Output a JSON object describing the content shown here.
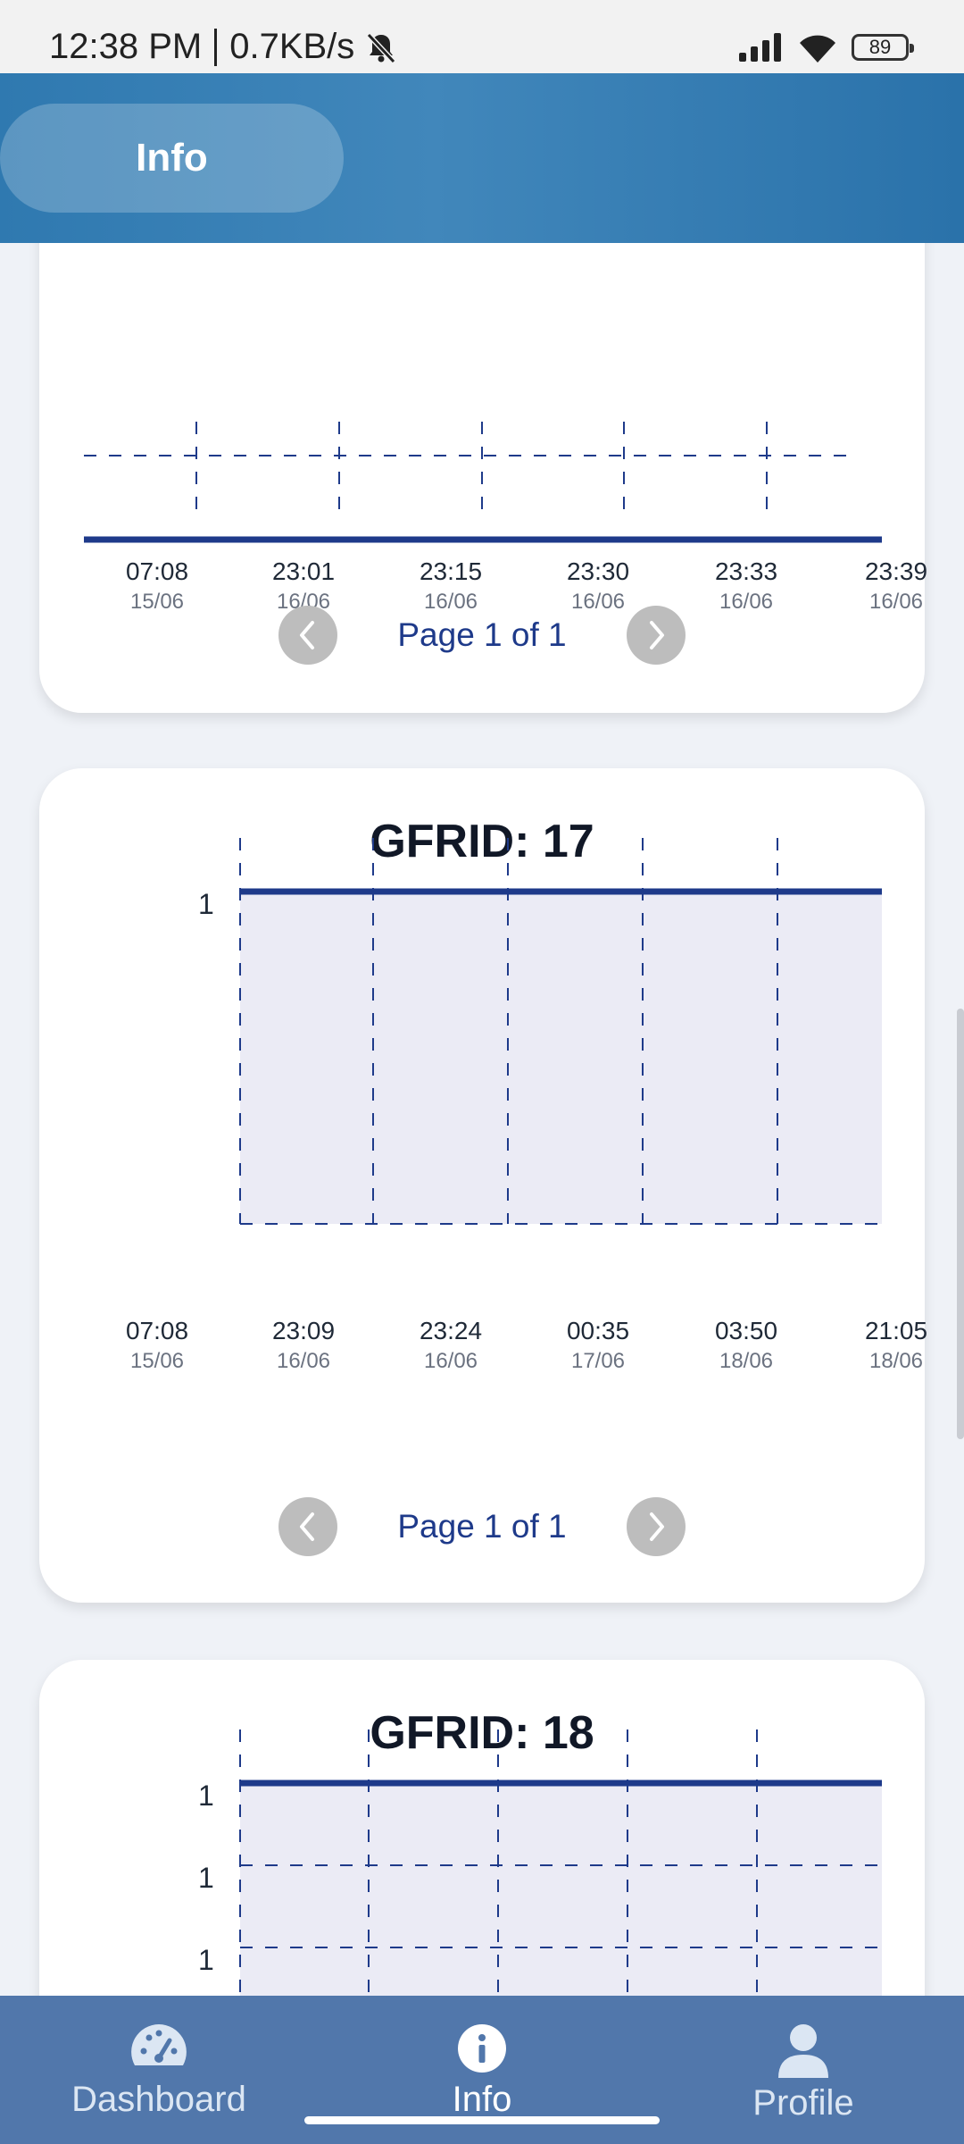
{
  "status_bar": {
    "time": "12:38 PM",
    "speed": "0.7KB/s",
    "battery": "89",
    "icons": [
      "bell-muted-icon",
      "signal-icon",
      "wifi-icon",
      "battery-icon"
    ]
  },
  "header": {
    "title": "Info"
  },
  "cards": [
    {
      "title": "",
      "pager": {
        "label": "Page 1 of 1"
      },
      "x_ticks": [
        {
          "time": "07:08",
          "date": "15/06"
        },
        {
          "time": "23:01",
          "date": "16/06"
        },
        {
          "time": "23:15",
          "date": "16/06"
        },
        {
          "time": "23:30",
          "date": "16/06"
        },
        {
          "time": "23:33",
          "date": "16/06"
        },
        {
          "time": "23:39",
          "date": "16/06"
        }
      ]
    },
    {
      "title": "GFRID: 17",
      "pager": {
        "label": "Page 1 of 1"
      },
      "y_ticks": [
        "1"
      ],
      "x_ticks": [
        {
          "time": "07:08",
          "date": "15/06"
        },
        {
          "time": "23:09",
          "date": "16/06"
        },
        {
          "time": "23:24",
          "date": "16/06"
        },
        {
          "time": "00:35",
          "date": "17/06"
        },
        {
          "time": "03:50",
          "date": "18/06"
        },
        {
          "time": "21:05",
          "date": "18/06"
        }
      ]
    },
    {
      "title": "GFRID: 18",
      "y_ticks": [
        "1",
        "1",
        "1"
      ]
    }
  ],
  "chart_data": [
    {
      "type": "area",
      "title": "",
      "categories": [
        "07:08 15/06",
        "23:01 16/06",
        "23:15 16/06",
        "23:30 16/06",
        "23:33 16/06",
        "23:39 16/06"
      ],
      "series": [
        {
          "values": [
            1,
            1,
            1,
            1,
            1,
            1
          ]
        }
      ],
      "grid": true,
      "color": "#1e3a8a"
    },
    {
      "type": "area",
      "title": "GFRID: 17",
      "categories": [
        "07:08 15/06",
        "23:09 16/06",
        "23:24 16/06",
        "00:35 17/06",
        "03:50 18/06",
        "21:05 18/06"
      ],
      "series": [
        {
          "values": [
            1,
            1,
            1,
            1,
            1,
            1
          ]
        }
      ],
      "y_ticks": [
        "1"
      ],
      "grid": true,
      "color": "#1e3a8a",
      "fill": "#ebebf5"
    },
    {
      "type": "area",
      "title": "GFRID: 18",
      "series": [
        {
          "values": [
            1,
            1,
            1,
            1,
            1,
            1
          ]
        }
      ],
      "y_ticks": [
        "1",
        "1",
        "1"
      ],
      "grid": true,
      "color": "#1e3a8a",
      "fill": "#ebebf5"
    }
  ],
  "bottom_nav": {
    "items": [
      {
        "label": "Dashboard",
        "icon": "gauge-icon",
        "active": false
      },
      {
        "label": "Info",
        "icon": "info-icon",
        "active": true
      },
      {
        "label": "Profile",
        "icon": "person-icon",
        "active": false
      }
    ]
  },
  "colors": {
    "header": "#2f79b0",
    "nav": "#5177ab",
    "line": "#1e3a8a",
    "area_fill": "#ebebf5",
    "pager_text": "#1e3a8a"
  }
}
